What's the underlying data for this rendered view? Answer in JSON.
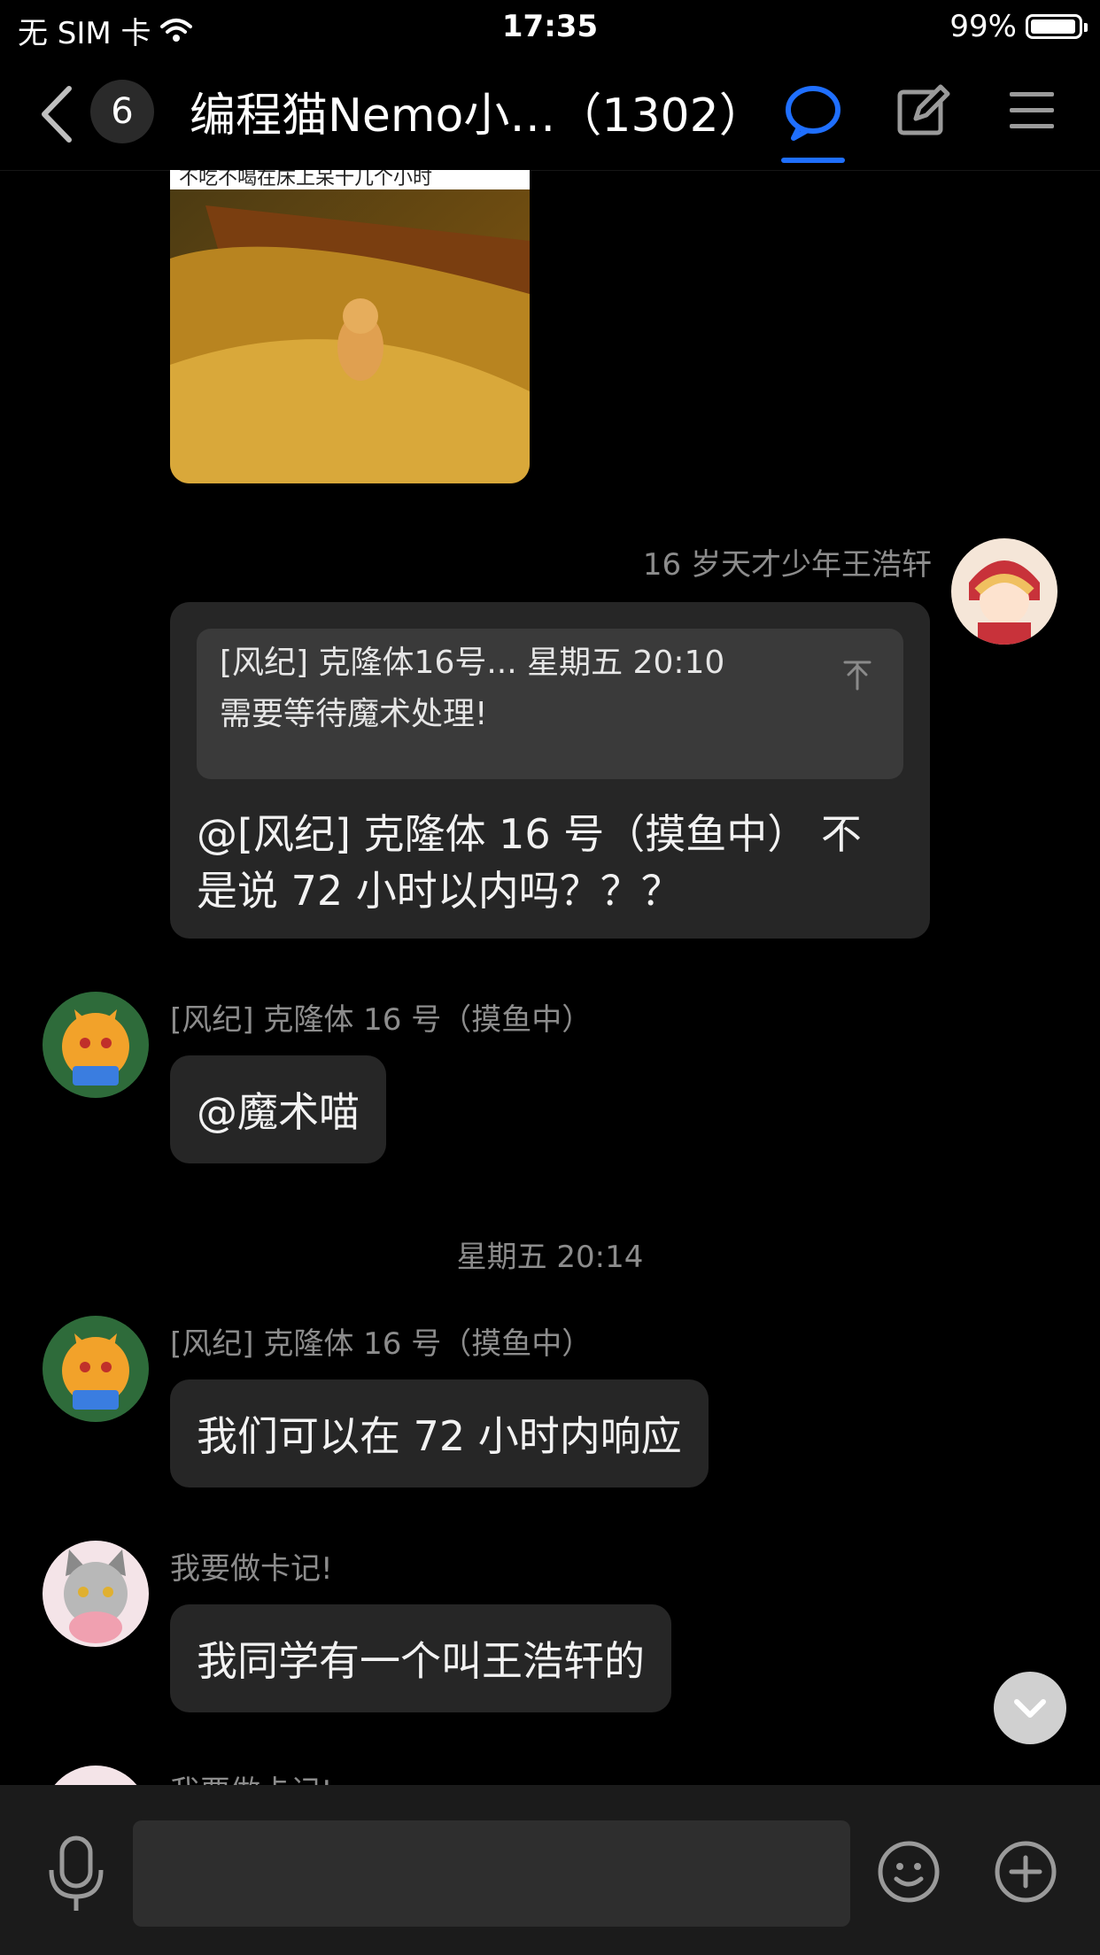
{
  "status_bar": {
    "carrier": "无 SIM 卡",
    "time": "17:35",
    "battery": "99%"
  },
  "nav": {
    "unread_count": "6",
    "title": "编程猫Nemo小…（1302）"
  },
  "image_message": {
    "caption_fragment": "不吃不喝在床上呆十几个小时"
  },
  "messages": [
    {
      "sender": "16 岁天才少年王浩轩",
      "quote": {
        "header": "[风纪] 克隆体16号... 星期五 20:10",
        "body": "需要等待魔术处理!"
      },
      "text_line1": "@[风纪] 克隆体 16 号（摸鱼中） 不",
      "text_line2": "是说 72 小时以内吗？？？"
    },
    {
      "sender": "[风纪] 克隆体 16 号（摸鱼中）",
      "text": "@魔术喵"
    },
    {
      "sender": "[风纪] 克隆体 16 号（摸鱼中）",
      "text": "我们可以在 72 小时内响应"
    },
    {
      "sender": "我要做卡记!",
      "text": "我同学有一个叫王浩轩的"
    },
    {
      "sender": "我要做卡记!"
    }
  ],
  "timestamp": "星期五 20:14",
  "input": {
    "placeholder": ""
  },
  "colors": {
    "accent": "#1f6fff",
    "bubble": "#262626",
    "background": "#000000"
  }
}
